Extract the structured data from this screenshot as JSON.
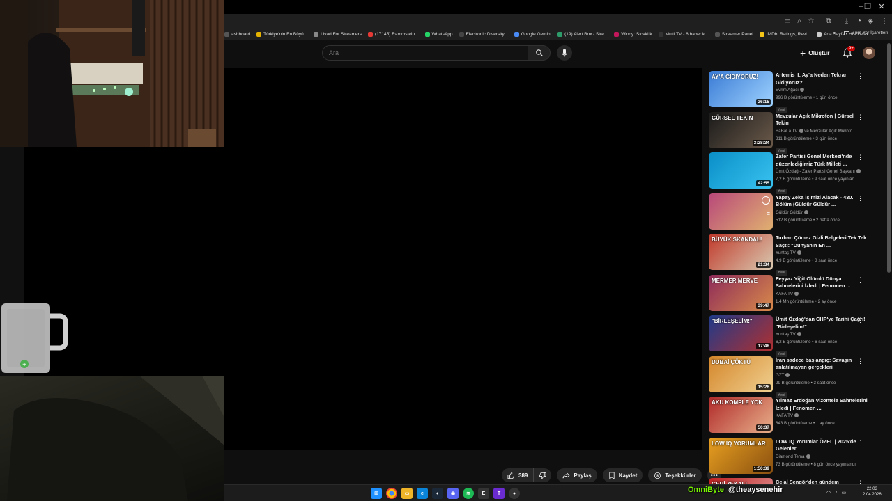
{
  "bookmarks": [
    {
      "label": "ashboard",
      "color": "#555"
    },
    {
      "label": "Türkiye'nin En Büyü...",
      "color": "#e6b400"
    },
    {
      "label": "Livad For Streamers",
      "color": "#888"
    },
    {
      "label": "(17145) Rammstein...",
      "color": "#e53935"
    },
    {
      "label": "WhatsApp",
      "color": "#25d366"
    },
    {
      "label": "Electronic Diversity...",
      "color": "#444"
    },
    {
      "label": "Google Gemini",
      "color": "#4a8af4"
    },
    {
      "label": "(19) Alert Box / Stre...",
      "color": "#2e9c6a"
    },
    {
      "label": "Windy: Sıcaklık",
      "color": "#c2185b"
    },
    {
      "label": "Multi TV - 6 haber k...",
      "color": "#333"
    },
    {
      "label": "Streamer Panel",
      "color": "#555"
    },
    {
      "label": "IMDb: Ratings, Revi...",
      "color": "#f5c518"
    },
    {
      "label": "Ana Sayfa • HBO Max",
      "color": "#ccc"
    }
  ],
  "bookmarks_overflow": "»",
  "bookmarks_all": "Tüm Yer İşaretleri",
  "header": {
    "search_placeholder": "Ara",
    "create_label": "Oluştur",
    "notif_badge": "9+"
  },
  "actions": {
    "like_count": "389",
    "share": "Paylaş",
    "save": "Kaydet",
    "thanks": "Teşekkürler"
  },
  "recommendations": [
    {
      "title": "Artemis II: Ay'a Neden Tekrar Gidiyoruz?",
      "channel": "Evrim Ağacı",
      "meta": "996 B görüntüleme • 1 gün önce",
      "badge": "Yeni",
      "duration": "26:15",
      "thumb_text": "AY'A GİDİYORUZ!",
      "c1": "#3a7bd5",
      "c2": "#9fd3ff"
    },
    {
      "title": "Mevzular Açık Mikrofon | Gürsel Tekin",
      "channel": "BaBaLa TV",
      "channel_extra": " ve Mevzular Açık Mikrofo...",
      "meta": "311 B görüntüleme • 3 gün önce",
      "badge": "Yeni",
      "duration": "3:28:34",
      "thumb_text": "GÜRSEL TEKİN",
      "c1": "#1a1a1a",
      "c2": "#6b5a4a"
    },
    {
      "title": "Zafer Partisi Genel Merkezi'nde düzenlediğimiz Türk Milleti ...",
      "channel": "Ümit Özdağ - Zafer Partisi Genel Başkanı",
      "meta": "7,2 B görüntüleme • 9 saat önce yayınlan...",
      "badge": "Yeni",
      "duration": "42:55",
      "thumb_text": "",
      "c1": "#0a8fc7",
      "c2": "#38c2f0"
    },
    {
      "title": "Yapay Zeka İşimizi Alacak - 430. Bölüm (Güldür Güldür ...",
      "channel": "Güldür Güldür",
      "meta": "512 B görüntüleme • 2 hafta önce",
      "badge": "",
      "duration": "",
      "thumb_text": "",
      "c1": "#b8487a",
      "c2": "#e0b070"
    },
    {
      "title": "Turhan Çömez Gizli Belgeleri Tek Tek Saçtı: \"Dünyanın En ...",
      "channel": "Yurttaş TV",
      "meta": "4,9 B görüntüleme • 3 saat önce",
      "badge": "Yeni",
      "duration": "21:34",
      "thumb_text": "BÜYÜK SKANDAL!",
      "c1": "#c0392b",
      "c2": "#d9c9b0"
    },
    {
      "title": "Feyyaz Yiğit Ölümlü Dünya Sahnelerini İzledi | Fenomen ...",
      "channel": "KAFA TV",
      "meta": "1,4 Mn görüntüleme • 2 ay önce",
      "badge": "",
      "duration": "39:47",
      "thumb_text": "MERMER MERVE",
      "c1": "#8e2a5a",
      "c2": "#d88a4a"
    },
    {
      "title": "Ümit Özdağ'dan CHP'ye Tarihi Çağrı! \"Birleşelim!\"",
      "channel": "Yurttaş TV",
      "meta": "6,2 B görüntüleme • 6 saat önce",
      "badge": "Yeni",
      "duration": "17:48",
      "thumb_text": "\"BİRLEŞELİM!\"",
      "c1": "#1f3a8a",
      "c2": "#b03030"
    },
    {
      "title": "İran sadece başlangıç: Savaşın anlatılmayan gerçekleri",
      "channel": "GZT",
      "meta": "29 B görüntüleme • 3 saat önce",
      "badge": "Yeni",
      "duration": "15:26",
      "thumb_text": "DUBAİ ÇÖKTÜ",
      "c1": "#d4862a",
      "c2": "#f0d090"
    },
    {
      "title": "Yılmaz Erdoğan Vizontele Sahnelerini İzledi | Fenomen ...",
      "channel": "KAFA TV",
      "meta": "843 B görüntüleme • 1 ay önce",
      "badge": "",
      "duration": "50:37",
      "thumb_text": "AKU KOMPLE YOK",
      "c1": "#b02a2a",
      "c2": "#e8b08a"
    },
    {
      "title": "LOW IQ Yorumlar ÖZEL | 2025'de Gelenler",
      "channel": "Diamond Tema",
      "meta": "73 B görüntüleme • 8 gün önce yayınlandı",
      "badge": "",
      "duration": "1:50:39",
      "thumb_text": "LOW IQ YORUMLAR",
      "c1": "#e8a020",
      "c2": "#8a5010"
    },
    {
      "title": "Celal Şengör'den gündem",
      "channel": "",
      "meta": "",
      "badge": "",
      "duration": "",
      "thumb_text": "GERİ ZEKALI",
      "c1": "#c02020",
      "c2": "#e0a0a0"
    }
  ],
  "overlay": {
    "brand": "OmniByte",
    "handle": "@theaysenehir"
  },
  "clock": {
    "time": "22:03",
    "date": "2.04.2026"
  }
}
